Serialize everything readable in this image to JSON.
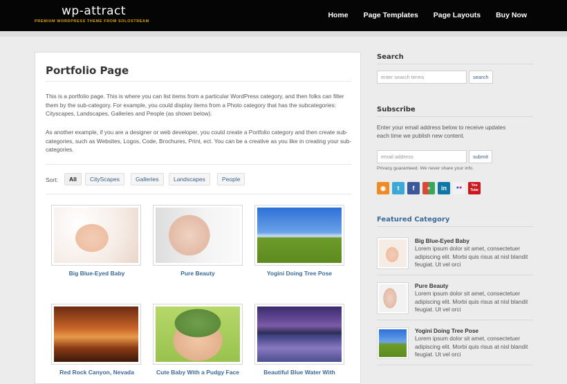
{
  "header": {
    "logo_title": "wp-attract",
    "logo_tagline": "PREMIUM WORDPRESS THEME FROM SOLOSTREAM",
    "nav": [
      "Home",
      "Page Templates",
      "Page Layouts",
      "Buy Now"
    ]
  },
  "main": {
    "title": "Portfolio Page",
    "paragraph_1": "This is a portfolio page. This is where you can list items from a particular WordPress category, and then folks can filter them by the sub-category. For example, you could display items from a Photo category that has the subcategories: Cityscapes, Landscapes, Galleries and People (as shown below).",
    "paragraph_2": "As another example, if you are a designer or web developer, you could create a Portfolio category and then create sub-categories, such as Websites, Logos, Code, Brochures, Print, ect. You can be a creative as you like in creating your sub-categories.",
    "sort_label": "Sort:",
    "filters": [
      "All",
      "CityScapes",
      "Galleries",
      "Landscapes",
      "People"
    ],
    "active_filter": "All",
    "portfolio": [
      {
        "caption": "Big Blue-Eyed Baby"
      },
      {
        "caption": "Pure Beauty"
      },
      {
        "caption": "Yogini Doing Tree Pose"
      },
      {
        "caption": "Red Rock Canyon, Nevada"
      },
      {
        "caption": "Cute Baby With a Pudgy Face"
      },
      {
        "caption": "Beautiful Blue Water With"
      }
    ]
  },
  "sidebar": {
    "search_heading": "Search",
    "search_placeholder": "enter search terms",
    "search_button": "search",
    "subscribe_heading": "Subscribe",
    "subscribe_text": "Enter your email address below to receive updates each time we publish new content.",
    "email_placeholder": "email address",
    "submit_button": "submit",
    "privacy_text": "Privacy guaranteed. We never share your info.",
    "social_icons": [
      "rss-icon",
      "twitter-icon",
      "facebook-icon",
      "google-plus-icon",
      "linkedin-icon",
      "flickr-icon",
      "youtube-icon"
    ],
    "social_youtube_label": "You Tube",
    "featured_heading": "Featured Category",
    "featured": [
      {
        "title": "Big Blue-Eyed Baby",
        "desc": "Lorem ipsum dolor sit amet, consectetuer adipiscing elit. Morbi quis risus at nisl blandit feugiat. Ut vel orci"
      },
      {
        "title": "Pure Beauty",
        "desc": "Lorem ipsum dolor sit amet, consectetuer adipiscing elit. Morbi quis risus at nisl blandit feugiat. Ut vel orci"
      },
      {
        "title": "Yogini Doing Tree Pose",
        "desc": "Lorem ipsum dolor sit amet, consectetuer adipiscing elit. Morbi quis risus at nisl blandit feugiat. Ut vel orci"
      }
    ]
  },
  "colors": {
    "header_bg": "#050505",
    "tagline": "#d9a400",
    "link_blue": "#3a6a9a",
    "page_bg": "#ececec"
  }
}
